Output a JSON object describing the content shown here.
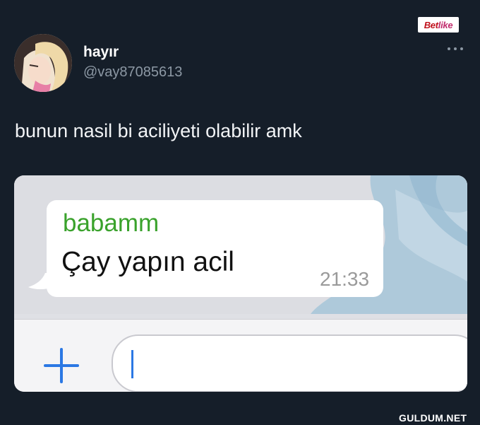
{
  "brand": {
    "logo_main": "Bet",
    "logo_accent": "like"
  },
  "tweet": {
    "display_name": "hayır",
    "handle": "@vay87085613",
    "text": "bunun nasil bi aciliyeti olabilir amk",
    "more_icon": "more-dots-icon"
  },
  "chat": {
    "sender": "babamm",
    "message": "Çay yapın acil",
    "time": "21:33",
    "add_icon": "plus-icon",
    "input_value": ""
  },
  "watermark": "GULDUM.NET",
  "colors": {
    "background": "#151e29",
    "sender_green": "#3aa22c",
    "accent_blue": "#2b78e4",
    "muted_text": "#8c98a4"
  }
}
